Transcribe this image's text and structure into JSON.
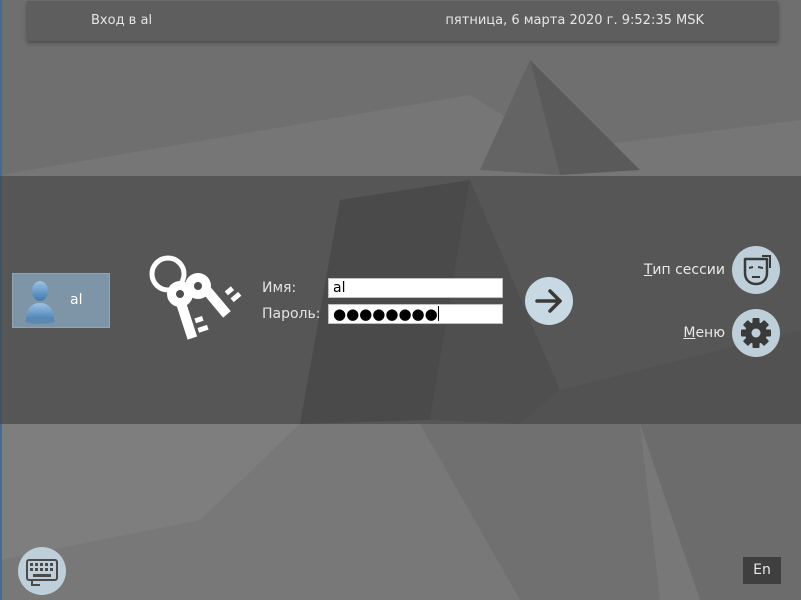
{
  "header": {
    "title": "Вход в al",
    "datetime": "пятница, 6 марта 2020 г. 9:52:35 MSK"
  },
  "user": {
    "name": "al",
    "avatar_icon": "user-avatar-icon"
  },
  "form": {
    "name_label": "Имя:",
    "name_value": "al",
    "password_label": "Пароль:",
    "password_mask": "●●●●●●●●"
  },
  "actions": {
    "login_icon": "arrow-right-icon",
    "session_type_prefix": "Т",
    "session_type_rest": "ип сессии",
    "session_icon": "mask-icon",
    "menu_prefix": "М",
    "menu_rest": "еню",
    "menu_icon": "gear-icon"
  },
  "footer": {
    "keyboard_icon": "keyboard-icon",
    "language": "En"
  },
  "colors": {
    "background": "#757575",
    "panel": "#4f4f4f",
    "button": "#bfcfd9",
    "user_card": "#7d95a6"
  }
}
